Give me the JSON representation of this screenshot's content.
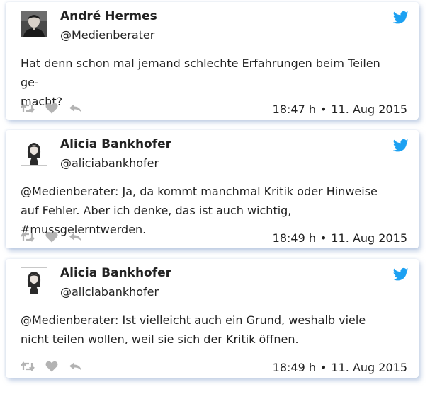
{
  "colors": {
    "accent": "#1da1f2",
    "action_icon": "#b3b3b3",
    "text": "#222222",
    "shadow": "#8ca5cd"
  },
  "tweets": [
    {
      "name": "André Hermes",
      "handle": "@Medienberater",
      "text": "Hat denn schon mal jemand schlechte Erfahrungen beim Teilen ge-\nmacht?",
      "time": "18:47 h",
      "separator": "•",
      "date": "11. Aug 2015",
      "avatar": "photo-avatar"
    },
    {
      "name": "Alicia Bankhofer",
      "handle": "@aliciabankhofer",
      "text": "@Medienberater: Ja, da kommt manchmal Kritik oder Hinweise auf Fehler. Aber ich denke, das ist auch wichtig, #mussgelerntwerden.",
      "time": "18:49 h",
      "separator": "•",
      "date": "11. Aug 2015",
      "avatar": "cartoon-avatar"
    },
    {
      "name": "Alicia Bankhofer",
      "handle": "@aliciabankhofer",
      "text": "@Medienberater: Ist vielleicht auch ein Grund, weshalb viele nicht teilen wollen, weil sie sich der Kritik öffnen.",
      "time": "18:49 h",
      "separator": "•",
      "date": "11. Aug 2015",
      "avatar": "cartoon-avatar"
    }
  ],
  "icons": {
    "brand": "twitter-bird-icon",
    "retweet": "retweet-icon",
    "like": "heart-icon",
    "reply": "reply-icon"
  }
}
